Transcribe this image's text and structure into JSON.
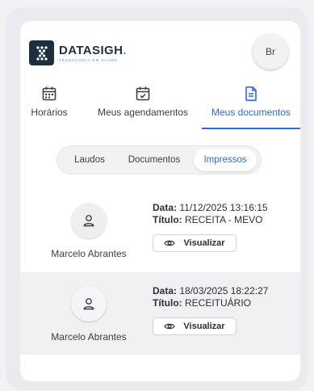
{
  "brand": {
    "name": "DATASIGH",
    "name_dot": ".",
    "tagline": "TECNOLOGIA EM SAÚDE"
  },
  "user_avatar": {
    "initials": "Br"
  },
  "tabs": [
    {
      "label": "Horários",
      "icon": "calendar-grid-icon",
      "active": false
    },
    {
      "label": "Meus agendamentos",
      "icon": "calendar-check-icon",
      "active": false
    },
    {
      "label": "Meus documentos",
      "icon": "document-icon",
      "active": true
    }
  ],
  "segments": [
    {
      "label": "Laudos",
      "active": false
    },
    {
      "label": "Documentos",
      "active": false
    },
    {
      "label": "Impressos",
      "active": true
    }
  ],
  "documents": [
    {
      "patient": "Marcelo Abrantes",
      "date_label": "Data:",
      "date_value": "11/12/2025 13:16:15",
      "title_label": "Título:",
      "title_value": "RECEITA - MEVO",
      "action": "Visualizar"
    },
    {
      "patient": "Marcelo Abrantes",
      "date_label": "Data:",
      "date_value": "18/03/2025 18:22:27",
      "title_label": "Título:",
      "title_value": "RECEITUÁRIO",
      "action": "Visualizar"
    }
  ],
  "colors": {
    "accent": "#2d6ad9",
    "brand_dark": "#1d2f3d",
    "brand_light": "#2ea3d4"
  }
}
